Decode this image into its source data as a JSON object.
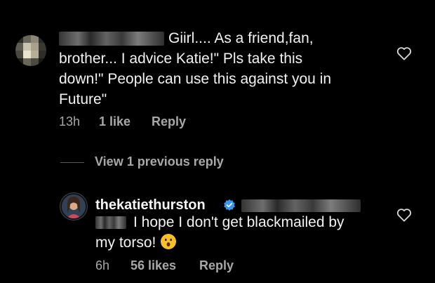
{
  "comment1": {
    "text_line1": "Giirl.... As a friend,fan,",
    "text_line2": "brother... I advice Katie!\" Pls take this",
    "text_line3": "down!\" People can use this against you in",
    "text_line4": "Future\"",
    "time": "13h",
    "likes": "1 like",
    "reply_label": "Reply",
    "heart_icon": "heart-outline-icon"
  },
  "replies_toggle": {
    "label": "View 1 previous reply"
  },
  "comment2": {
    "username": "thekatiethurston",
    "text_line1": "I hope I don't get blackmailed by",
    "text_line2": "my torso!",
    "emoji": "astonished-face-emoji",
    "time": "6h",
    "likes": "56 likes",
    "reply_label": "Reply",
    "heart_icon": "heart-outline-icon"
  },
  "colors": {
    "background": "#000000",
    "text": "#f5f5f5",
    "meta": "#a8a8a8",
    "verified": "#3897f0"
  }
}
